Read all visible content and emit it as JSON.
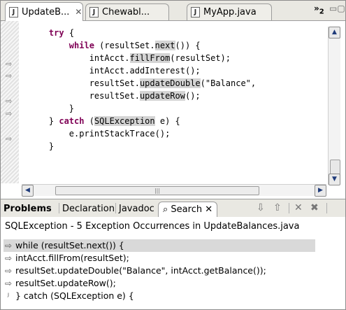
{
  "editor_tabs": [
    {
      "label": "UpdateB...",
      "icon": "java-file-icon",
      "close": "✕",
      "active": true
    },
    {
      "label": "Chewabl...",
      "icon": "java-file-icon",
      "active": false
    },
    {
      "label": "MyApp.java",
      "icon": "java-file-icon",
      "active": false
    }
  ],
  "overflow": {
    "chevrons": "»",
    "count": "2"
  },
  "code_lines": [
    {
      "indent": "    ",
      "parts": [
        {
          "t": "try",
          "k": "kw"
        },
        {
          "t": " {"
        }
      ]
    },
    {
      "indent": "        ",
      "parts": [
        {
          "t": "while",
          "k": "kw"
        },
        {
          "t": " (resultSet."
        },
        {
          "t": "next",
          "k": "hl"
        },
        {
          "t": "()) {"
        }
      ]
    },
    {
      "indent": "            ",
      "parts": [
        {
          "t": "intAcct."
        },
        {
          "t": "fillFrom",
          "k": "hl"
        },
        {
          "t": "(resultSet);"
        }
      ]
    },
    {
      "indent": "            ",
      "parts": [
        {
          "t": "intAcct.addInterest();"
        }
      ]
    },
    {
      "indent": "            ",
      "parts": [
        {
          "t": "resultSet."
        },
        {
          "t": "updateDouble",
          "k": "hl"
        },
        {
          "t": "(\"Balance\","
        }
      ]
    },
    {
      "indent": "            ",
      "parts": [
        {
          "t": "resultSet."
        },
        {
          "t": "updateRow",
          "k": "hl"
        },
        {
          "t": "();"
        }
      ]
    },
    {
      "indent": "        ",
      "parts": [
        {
          "t": "}"
        }
      ]
    },
    {
      "indent": "    ",
      "parts": [
        {
          "t": "} "
        },
        {
          "t": "catch",
          "k": "kw"
        },
        {
          "t": " ("
        },
        {
          "t": "SQLException",
          "k": "hl"
        },
        {
          "t": " e) {"
        }
      ]
    },
    {
      "indent": "        ",
      "parts": [
        {
          "t": "e.printStackTrace();"
        }
      ]
    },
    {
      "indent": "    ",
      "parts": [
        {
          "t": "}"
        }
      ]
    }
  ],
  "view_tabs": {
    "problems": "Problems",
    "declaration": "Declaration",
    "javadoc": "Javadoc",
    "search": "Search",
    "search_close": "✕"
  },
  "search": {
    "summary": "SQLException - 5 Exception Occurrences in UpdateBalances.java",
    "results": [
      {
        "text": "while (resultSet.next()) {",
        "icon": "occurrence-arrow-icon",
        "selected": true
      },
      {
        "text": "intAcct.fillFrom(resultSet);",
        "icon": "occurrence-arrow-icon",
        "selected": false
      },
      {
        "text": "resultSet.updateDouble(\"Balance\", intAcct.getBalance());",
        "icon": "occurrence-arrow-icon",
        "selected": false
      },
      {
        "text": "resultSet.updateRow();",
        "icon": "occurrence-arrow-icon",
        "selected": false
      },
      {
        "text": "} catch (SQLException e) {",
        "icon": "catch-block-icon",
        "selected": false
      }
    ]
  },
  "colors": {
    "keyword": "#7f0055",
    "highlight": "#d4d4d4",
    "selection": "#d9d9d9"
  }
}
